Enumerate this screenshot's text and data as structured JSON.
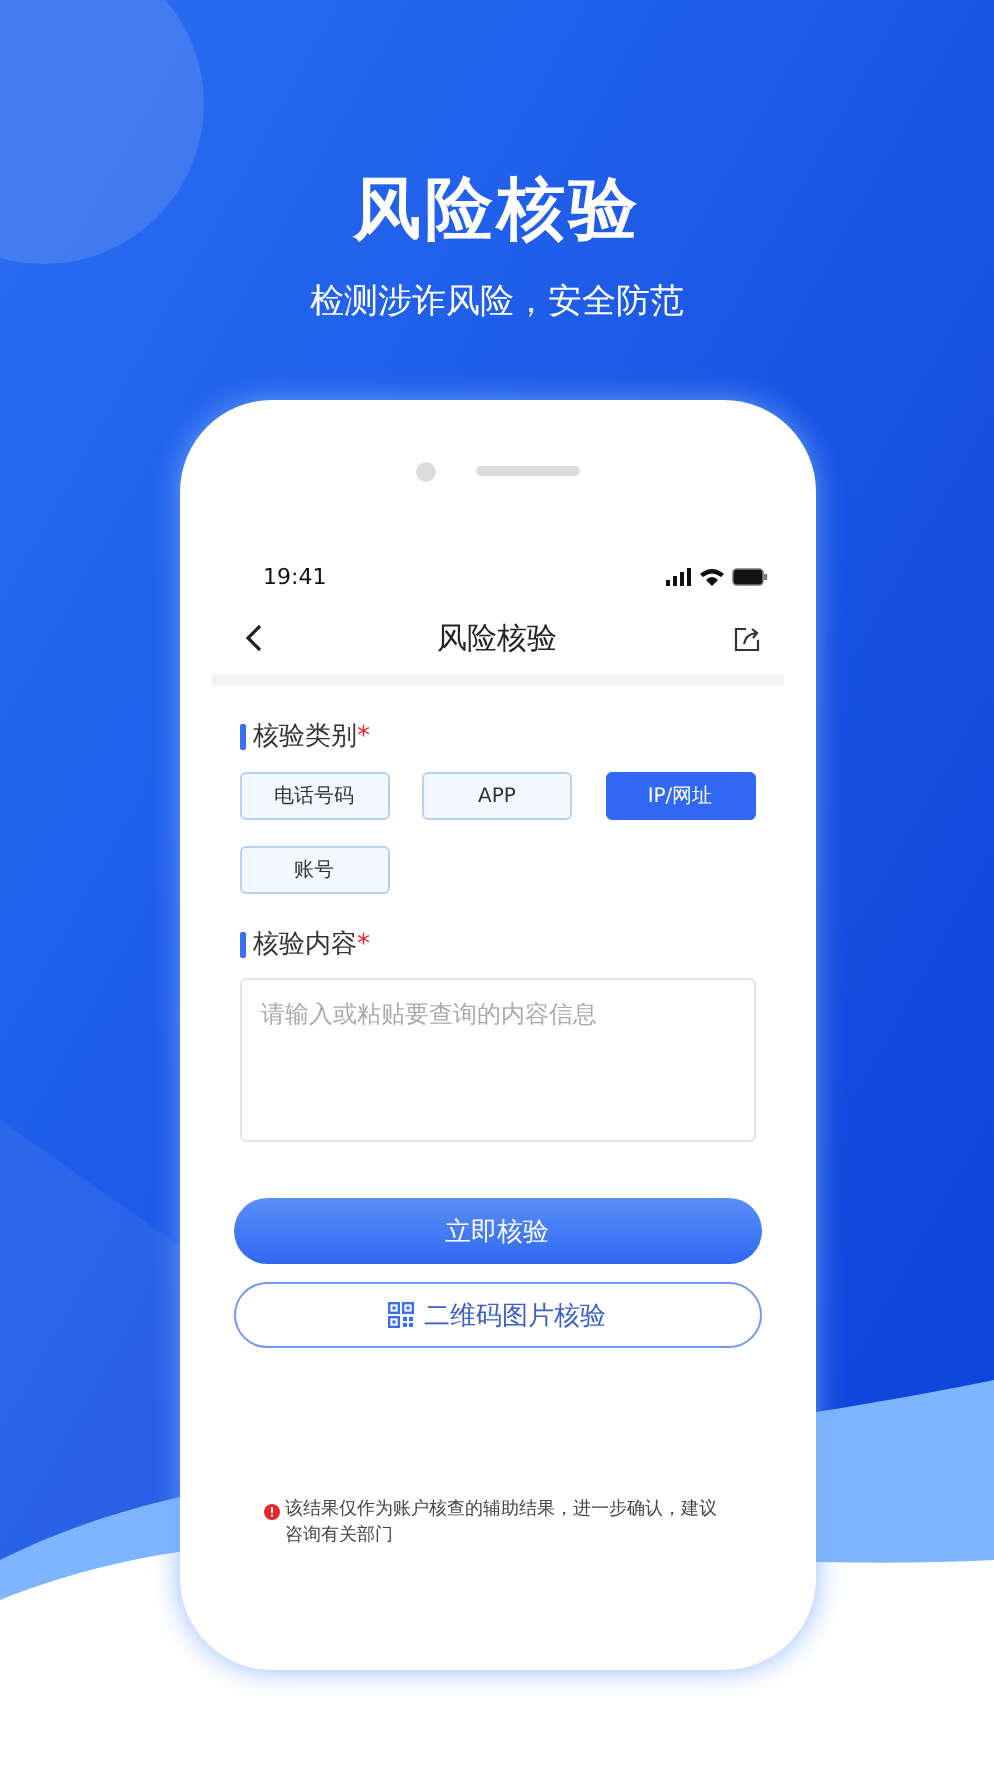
{
  "headline": {
    "title": "风险核验",
    "subtitle": "检测涉诈风险，安全防范"
  },
  "status_bar": {
    "time": "19:41"
  },
  "nav": {
    "title": "风险核验"
  },
  "category": {
    "label": "核验类别",
    "required": "*",
    "options": [
      {
        "label": "电话号码",
        "selected": false
      },
      {
        "label": "APP",
        "selected": false
      },
      {
        "label": "IP/网址",
        "selected": true
      },
      {
        "label": "账号",
        "selected": false
      }
    ]
  },
  "content": {
    "label": "核验内容",
    "required": "*",
    "placeholder": "请输入或粘贴要查询的内容信息"
  },
  "buttons": [
    {
      "kind": "primary",
      "label": "立即核验"
    },
    {
      "kind": "qr",
      "label": "二维码图片核验"
    }
  ],
  "notice": "该结果仅作为账户核查的辅助结果，进一步确认，建议咨询有关部门"
}
